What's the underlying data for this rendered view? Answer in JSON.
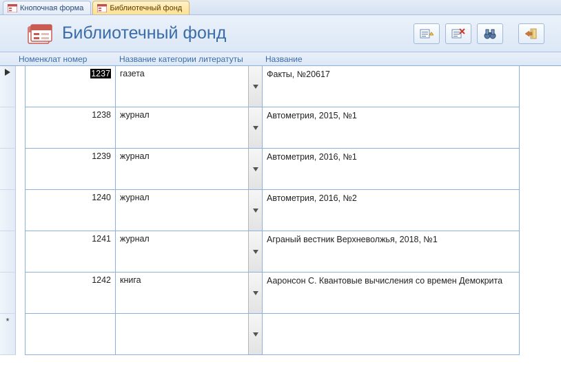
{
  "tabs": [
    {
      "label": "Кнопочная форма",
      "active": false
    },
    {
      "label": "Библиотечный фонд",
      "active": true
    }
  ],
  "title": "Библиотечный фонд",
  "columns": {
    "id": "Номенклат номер",
    "category": "Название категории литератуты",
    "name": "Название"
  },
  "rows": [
    {
      "id": "1237",
      "category": "газета",
      "name": "Факты, №20617",
      "selected": true,
      "current": true
    },
    {
      "id": "1238",
      "category": "журнал",
      "name": "Автометрия, 2015, №1"
    },
    {
      "id": "1239",
      "category": "журнал",
      "name": "Автометрия, 2016, №1"
    },
    {
      "id": "1240",
      "category": "журнал",
      "name": "Автометрия, 2016, №2"
    },
    {
      "id": "1241",
      "category": "журнал",
      "name": "Аграный вестник Верхневолжья, 2018, №1"
    },
    {
      "id": "1242",
      "category": "книга",
      "name": "Ааронсон С. Квантовые вычисления со времен Демокрита"
    },
    {
      "id": "",
      "category": "",
      "name": "",
      "new": true
    }
  ],
  "toolbar": {
    "new": "new-record",
    "delete": "delete-record",
    "find": "find",
    "close": "close"
  }
}
